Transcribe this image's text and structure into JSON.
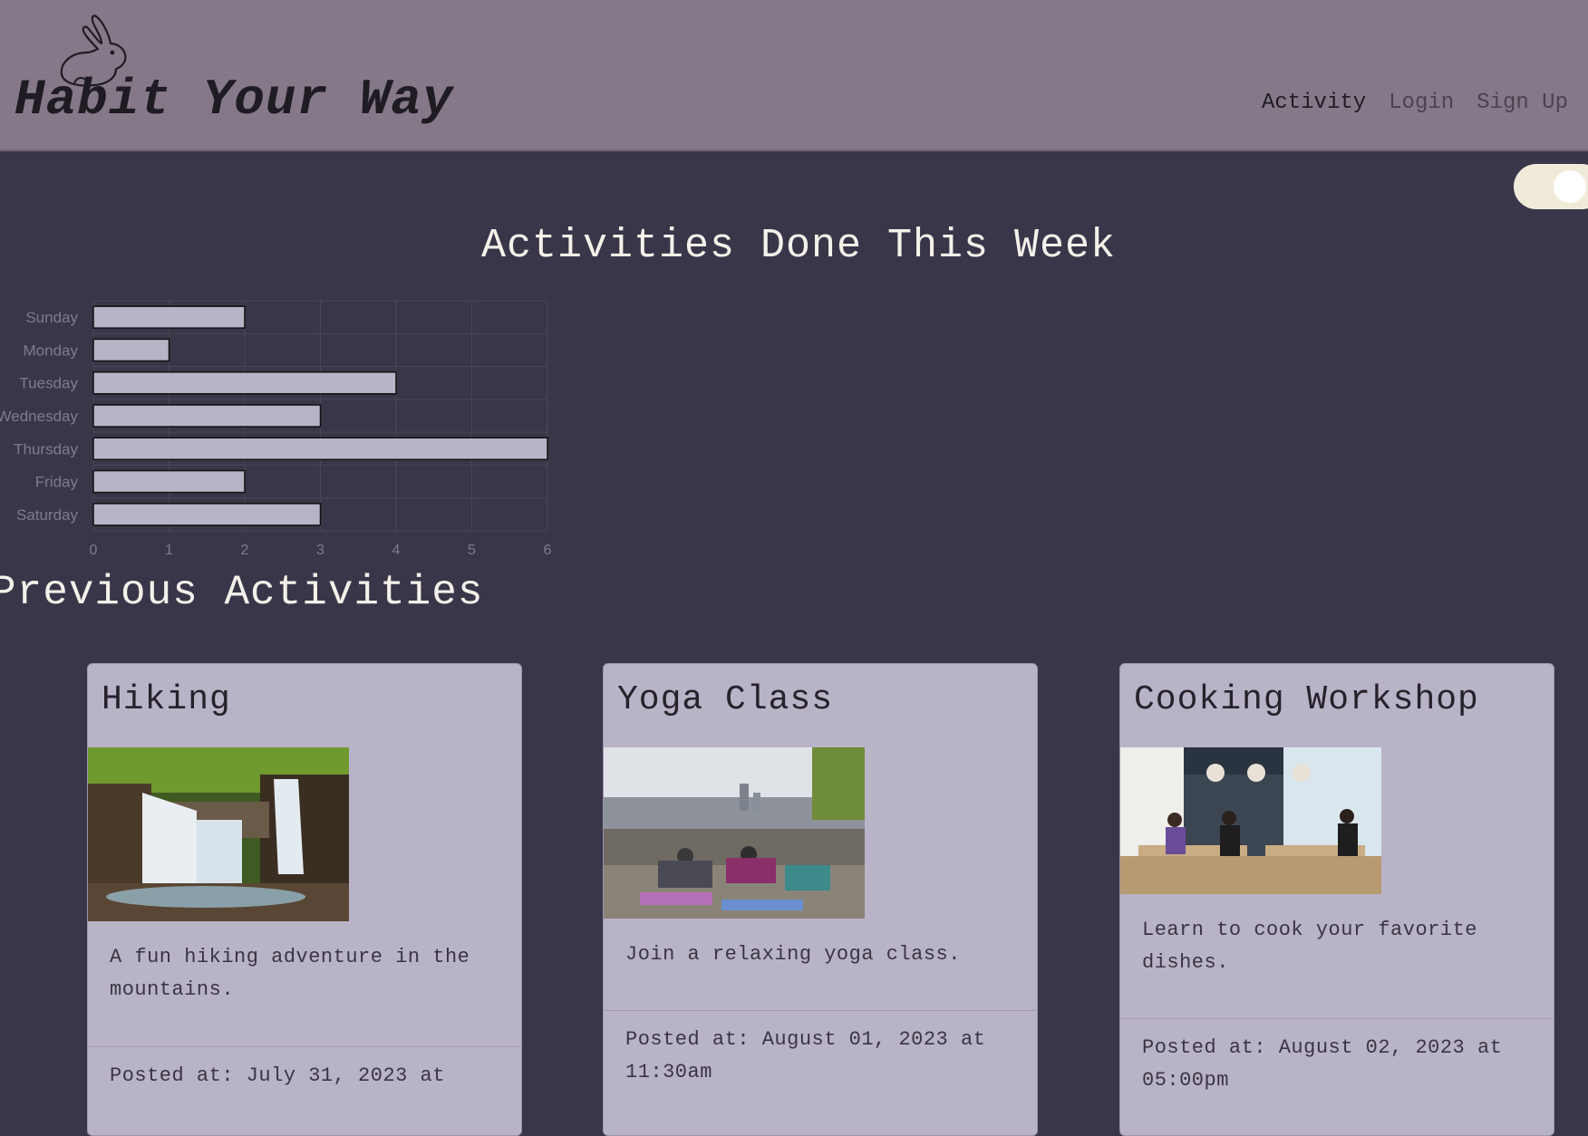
{
  "header": {
    "brand": "Habit Your Way",
    "logo_icon": "rabbit-icon",
    "nav": [
      {
        "label": "Activity",
        "active": true
      },
      {
        "label": "Login",
        "active": false
      },
      {
        "label": "Sign Up",
        "active": false
      }
    ]
  },
  "theme_toggle": {
    "icon": "theme-toggle",
    "state": "on"
  },
  "chart_section": {
    "title": "Activities Done This Week"
  },
  "chart_data": {
    "type": "bar",
    "orientation": "horizontal",
    "title": "Activities Done This Week",
    "categories": [
      "Sunday",
      "Monday",
      "Tuesday",
      "Wednesday",
      "Thursday",
      "Friday",
      "Saturday"
    ],
    "values": [
      2,
      1,
      4,
      3,
      6,
      2,
      3
    ],
    "xlim": [
      0,
      6
    ],
    "xticks": [
      "0",
      "1",
      "2",
      "3",
      "4",
      "5",
      "6"
    ],
    "xlabel": "",
    "ylabel": "",
    "grid": true,
    "colors": {
      "bar": "#b9b3c8",
      "bar_border": "#111111",
      "grid": "#4a4658",
      "tick": "#807a8e"
    }
  },
  "previous": {
    "title": "Previous Activities",
    "cards": [
      {
        "title": "Hiking",
        "image_icon": "waterfall-photo",
        "description": "A fun hiking adventure in the mountains.",
        "posted": "Posted at: July 31, 2023 at"
      },
      {
        "title": "Yoga Class",
        "image_icon": "yoga-photo",
        "description": "Join a relaxing yoga class.",
        "posted": "Posted at: August 01, 2023 at 11:30am"
      },
      {
        "title": "Cooking Workshop",
        "image_icon": "kitchen-photo",
        "description": "Learn to cook your favorite dishes.",
        "posted": "Posted at: August 02, 2023 at 05:00pm"
      }
    ]
  },
  "colors": {
    "background": "#3a3649",
    "header": "#857989",
    "card": "#b9b3c8",
    "heading_text": "#f4f1ea",
    "toggle": "#f0ead9"
  }
}
